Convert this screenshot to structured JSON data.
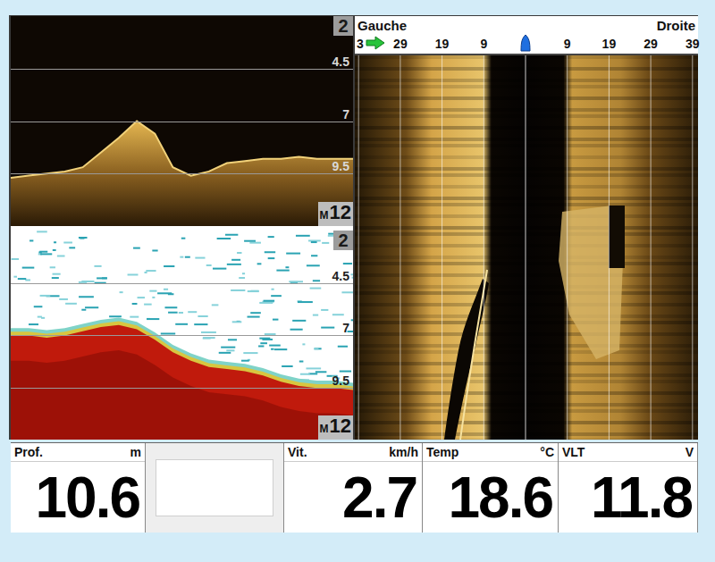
{
  "echo_panels": [
    {
      "kind": "down",
      "scale": {
        "labels": [
          "2",
          "4.5",
          "7",
          "9.5"
        ],
        "unit": "M",
        "max": "12"
      },
      "bottom_depths": [
        9.7,
        9.6,
        9.5,
        9.4,
        9.2,
        8.5,
        7.8,
        7.0,
        7.6,
        9.2,
        9.6,
        9.4,
        9.0,
        8.9,
        8.8,
        8.8,
        8.7,
        8.8,
        8.8,
        8.8
      ]
    },
    {
      "kind": "sonar",
      "scale": {
        "labels": [
          "2",
          "4.5",
          "7",
          "9.5"
        ],
        "unit": "M",
        "max": "12"
      },
      "bottom_depths": [
        7.0,
        7.0,
        7.1,
        7.0,
        6.8,
        6.6,
        6.5,
        6.7,
        7.2,
        7.8,
        8.2,
        8.5,
        8.6,
        8.7,
        8.9,
        9.2,
        9.4,
        9.5,
        9.5,
        9.6
      ]
    }
  ],
  "side_imaging": {
    "left_label": "Gauche",
    "right_label": "Droite",
    "left_ticks": [
      "3",
      "29",
      "19",
      "9"
    ],
    "right_ticks": [
      "9",
      "19",
      "29",
      "39"
    ]
  },
  "readouts": [
    {
      "kind": "reading",
      "label": "Prof.",
      "unit": "m",
      "value": "10.6"
    },
    {
      "kind": "blank",
      "label": "",
      "unit": "",
      "value": ""
    },
    {
      "kind": "reading",
      "label": "Vit.",
      "unit": "km/h",
      "value": "2.7"
    },
    {
      "kind": "reading",
      "label": "Temp",
      "unit": "°C",
      "value": "18.6"
    },
    {
      "kind": "reading",
      "label": "VLT",
      "unit": "V",
      "value": "11.8"
    }
  ]
}
